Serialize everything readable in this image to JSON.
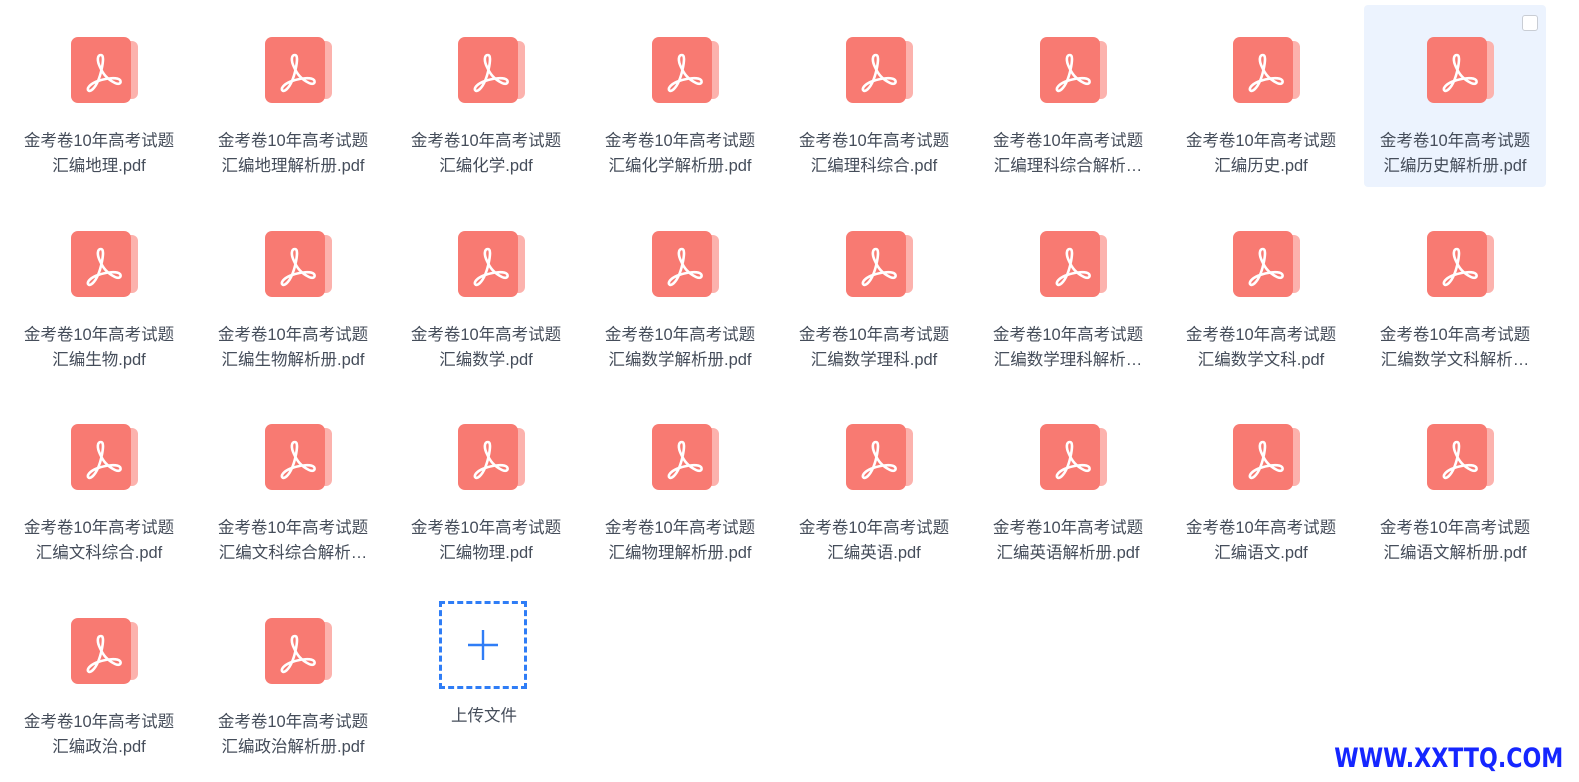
{
  "files": [
    {
      "line1": "金考卷10年高考试题",
      "line2": "汇编地理.pdf",
      "selected": false
    },
    {
      "line1": "金考卷10年高考试题",
      "line2": "汇编地理解析册.pdf",
      "selected": false
    },
    {
      "line1": "金考卷10年高考试题",
      "line2": "汇编化学.pdf",
      "selected": false
    },
    {
      "line1": "金考卷10年高考试题",
      "line2": "汇编化学解析册.pdf",
      "selected": false
    },
    {
      "line1": "金考卷10年高考试题",
      "line2": "汇编理科综合.pdf",
      "selected": false
    },
    {
      "line1": "金考卷10年高考试题",
      "line2": "汇编理科综合解析…",
      "selected": false
    },
    {
      "line1": "金考卷10年高考试题",
      "line2": "汇编历史.pdf",
      "selected": false
    },
    {
      "line1": "金考卷10年高考试题",
      "line2": "汇编历史解析册.pdf",
      "selected": true
    },
    {
      "line1": "金考卷10年高考试题",
      "line2": "汇编生物.pdf",
      "selected": false
    },
    {
      "line1": "金考卷10年高考试题",
      "line2": "汇编生物解析册.pdf",
      "selected": false
    },
    {
      "line1": "金考卷10年高考试题",
      "line2": "汇编数学.pdf",
      "selected": false
    },
    {
      "line1": "金考卷10年高考试题",
      "line2": "汇编数学解析册.pdf",
      "selected": false
    },
    {
      "line1": "金考卷10年高考试题",
      "line2": "汇编数学理科.pdf",
      "selected": false
    },
    {
      "line1": "金考卷10年高考试题",
      "line2": "汇编数学理科解析…",
      "selected": false
    },
    {
      "line1": "金考卷10年高考试题",
      "line2": "汇编数学文科.pdf",
      "selected": false
    },
    {
      "line1": "金考卷10年高考试题",
      "line2": "汇编数学文科解析…",
      "selected": false
    },
    {
      "line1": "金考卷10年高考试题",
      "line2": "汇编文科综合.pdf",
      "selected": false
    },
    {
      "line1": "金考卷10年高考试题",
      "line2": "汇编文科综合解析…",
      "selected": false
    },
    {
      "line1": "金考卷10年高考试题",
      "line2": "汇编物理.pdf",
      "selected": false
    },
    {
      "line1": "金考卷10年高考试题",
      "line2": "汇编物理解析册.pdf",
      "selected": false
    },
    {
      "line1": "金考卷10年高考试题",
      "line2": "汇编英语.pdf",
      "selected": false
    },
    {
      "line1": "金考卷10年高考试题",
      "line2": "汇编英语解析册.pdf",
      "selected": false
    },
    {
      "line1": "金考卷10年高考试题",
      "line2": "汇编语文.pdf",
      "selected": false
    },
    {
      "line1": "金考卷10年高考试题",
      "line2": "汇编语文解析册.pdf",
      "selected": false
    },
    {
      "line1": "金考卷10年高考试题",
      "line2": "汇编政治.pdf",
      "selected": false
    },
    {
      "line1": "金考卷10年高考试题",
      "line2": "汇编政治解析册.pdf",
      "selected": false
    }
  ],
  "upload": {
    "label": "上传文件",
    "icon": "plus-icon"
  },
  "file_icon": "pdf-file-icon",
  "watermark": "WWW.XXTTQ.COM",
  "colors": {
    "pdf_main": "#f87a72",
    "pdf_back": "#fcb2ad",
    "selected_bg": "#ecf3fe",
    "upload_accent": "#2f7df6",
    "text": "#454d5a",
    "watermark": "#1526ff"
  }
}
